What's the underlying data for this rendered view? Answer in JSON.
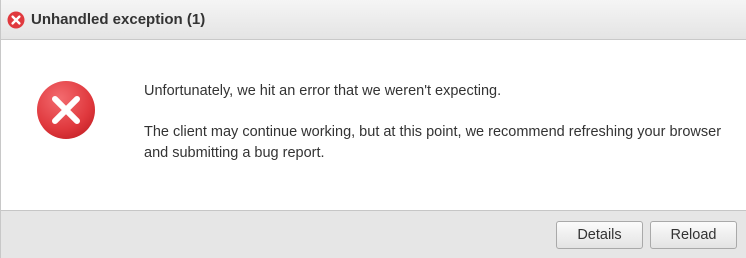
{
  "dialog": {
    "title": "Unhandled exception (1)",
    "title_icon": "error-circle-icon",
    "error_icon": "error-x-icon",
    "accent_color": "#e0393e",
    "message_line1": "Unfortunately, we hit an error that we weren't expecting.",
    "message_line2": "The client may continue working, but at this point, we recommend refreshing your browser and submitting a bug report."
  },
  "footer": {
    "details_label": "Details",
    "reload_label": "Reload"
  }
}
